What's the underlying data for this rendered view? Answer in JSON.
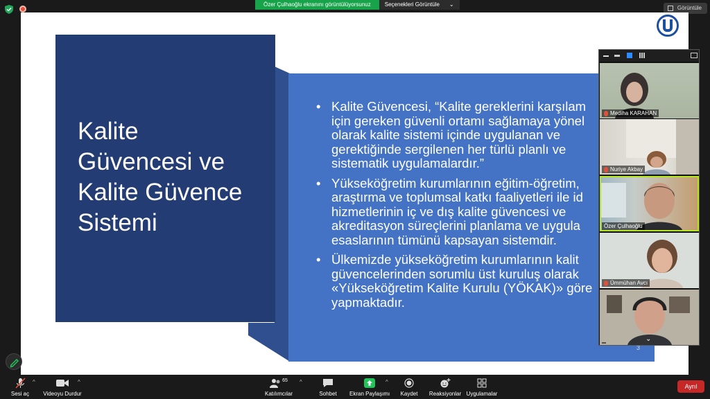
{
  "share_banner": {
    "status_text": "Özer Çulhaoğlu ekranını görüntülüyorsunuz",
    "options_label": "Seçenekleri Görüntüle"
  },
  "view_button_label": "Görüntüle",
  "slide": {
    "title_lines": [
      "Kalite",
      "Güvencesi ve",
      "Kalite Güvence",
      "Sistemi"
    ],
    "bullets": [
      [
        "Kalite Güvencesi, “Kalite gereklerini karşılam",
        "için gereken güvenli ortamı sağlamaya yönel",
        "olarak kalite sistemi içinde uygulanan ve",
        "gerektiğinde sergilenen her türlü planlı ve",
        "sistematik uygulamalardır.”"
      ],
      [
        "Yükseköğretim kurumlarının eğitim-öğretim,",
        "araştırma ve toplumsal katkı faaliyetleri ile id",
        "hizmetlerinin iç ve dış kalite güvencesi ve",
        "akreditasyon süreçlerini planlama ve uygula",
        "esaslarının tümünü kapsayan sistemdir."
      ],
      [
        "Ülkemizde yükseköğretim kurumlarının kalit",
        "güvencelerinden sorumlu üst kuruluş olarak",
        "«Yükseköğretim Kalite Kurulu (YÖKAK)» göre",
        "yapmaktadır."
      ]
    ],
    "page_number": "3"
  },
  "participants": [
    {
      "name": "Mediha KARAHAN",
      "muted": true
    },
    {
      "name": "Nuriye Akbay",
      "muted": true
    },
    {
      "name": "Özer Çulhaoğlu",
      "muted": false
    },
    {
      "name": "Ümmühan Avcı",
      "muted": true
    },
    {
      "name": "",
      "muted": false
    }
  ],
  "toolbar": {
    "mute_label": "Sesi aç",
    "video_label": "Videoyu Durdur",
    "participants_label": "Katılımcılar",
    "participants_count": "65",
    "chat_label": "Sohbet",
    "share_label": "Ekran Paylaşımı",
    "record_label": "Kaydet",
    "reactions_label": "Reaksiyonlar",
    "apps_label": "Uygulamalar",
    "leave_label": "Ayrıl"
  },
  "colors": {
    "title_box": "#243c74",
    "content_box": "#4472c4",
    "share_green": "#17a34a",
    "leave_red": "#c62828",
    "active_speaker": "#b5e61d"
  }
}
